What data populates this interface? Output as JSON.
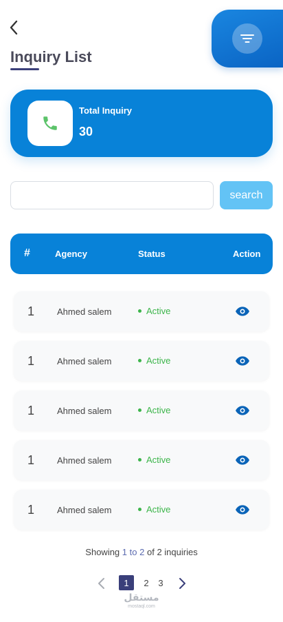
{
  "header": {
    "title": "Inquiry List",
    "back_icon": "chevron-left-icon",
    "filter_icon": "filter-icon"
  },
  "total_card": {
    "label": "Total Inquiry",
    "value": "30",
    "icon": "phone-icon"
  },
  "search": {
    "placeholder": "",
    "value": "",
    "button_label": "search"
  },
  "table": {
    "columns": [
      "#",
      "Agency",
      "Status",
      "Action"
    ],
    "rows": [
      {
        "num": "1",
        "agency": "Ahmed salem",
        "status": "Active",
        "action_icon": "eye-icon"
      },
      {
        "num": "1",
        "agency": "Ahmed salem",
        "status": "Active",
        "action_icon": "eye-icon"
      },
      {
        "num": "1",
        "agency": "Ahmed salem",
        "status": "Active",
        "action_icon": "eye-icon"
      },
      {
        "num": "1",
        "agency": "Ahmed salem",
        "status": "Active",
        "action_icon": "eye-icon"
      },
      {
        "num": "1",
        "agency": "Ahmed salem",
        "status": "Active",
        "action_icon": "eye-icon"
      }
    ]
  },
  "summary": {
    "prefix": "Showing",
    "from": "1",
    "to_word": "to",
    "to": "2",
    "suffix": "of 2 inquiries"
  },
  "pagination": {
    "pages": [
      "1",
      "2",
      "3"
    ],
    "current": "1"
  },
  "watermark": {
    "arabic": "مستقل",
    "latin": "mostaql.com"
  },
  "colors": {
    "primary": "#0882d8",
    "accent_light": "#63c3f5",
    "active_green": "#3cb54a",
    "indigo": "#3a3f7a"
  }
}
